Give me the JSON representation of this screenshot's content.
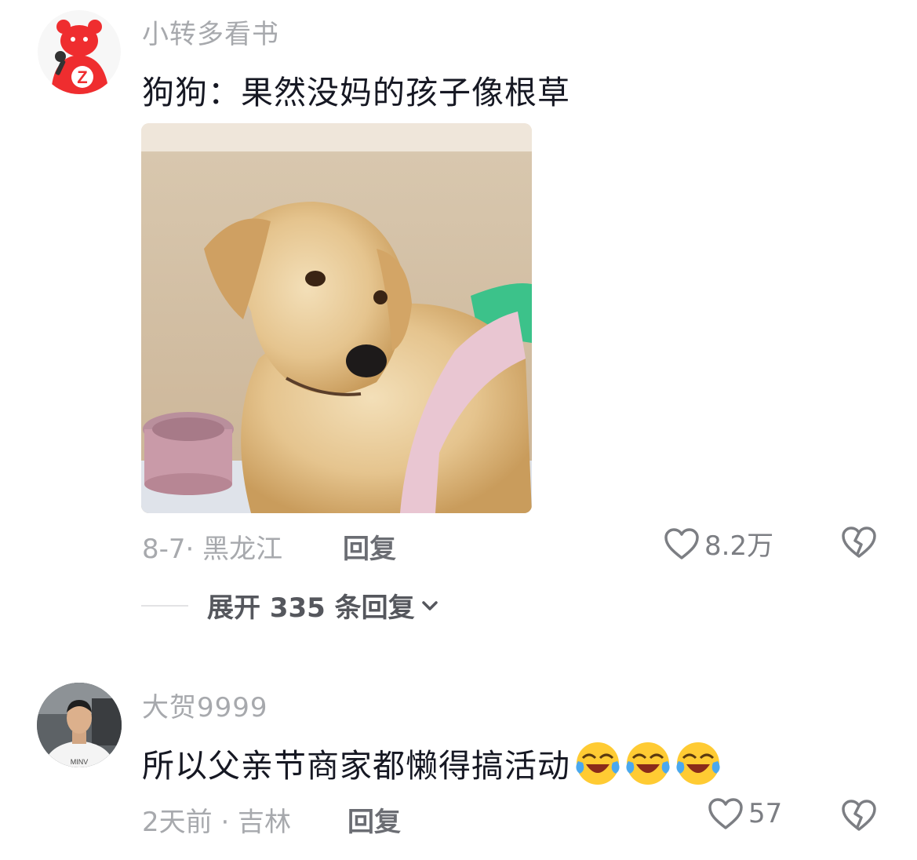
{
  "comments": [
    {
      "username": "小转多看书",
      "text": "狗狗：果然没妈的孩子像根草",
      "date_location": "8-7· 黑龙江",
      "reply_label": "回复",
      "likes": "8.2万",
      "expand_label": "展开 335 条回复",
      "avatar_letter": "Z"
    },
    {
      "username": "大贺9999",
      "text": "所以父亲节商家都懒得搞活动",
      "date_location": "2天前 · 吉林",
      "reply_label": "回复",
      "likes": "57",
      "avatar_shirt_text": "MINV"
    }
  ],
  "colors": {
    "primary_text": "#161823",
    "secondary_text": "#a7a9ad",
    "avatar_red": "#ef2d2f"
  },
  "icons": [
    "heart-outline-icon",
    "broken-heart-icon",
    "chevron-down-icon",
    "laughing-crying-emoji"
  ]
}
